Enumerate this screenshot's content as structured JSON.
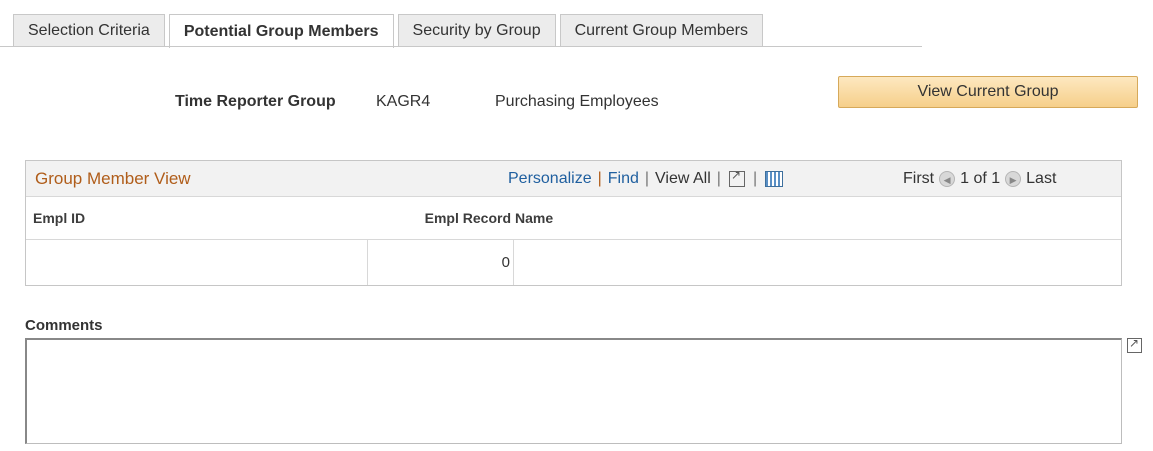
{
  "tabs": [
    {
      "label": "Selection Criteria",
      "active": false
    },
    {
      "label": "Potential Group Members",
      "active": true
    },
    {
      "label": "Security by Group",
      "active": false
    },
    {
      "label": "Current Group Members",
      "active": false
    }
  ],
  "header": {
    "label": "Time Reporter Group",
    "code": "KAGR4",
    "description": "Purchasing Employees",
    "button_label": "View Current Group"
  },
  "grid": {
    "title": "Group Member View",
    "personalize": "Personalize",
    "find": "Find",
    "view_all": "View All",
    "first": "First",
    "page_info": "1 of 1",
    "last": "Last",
    "columns": {
      "empl_id": "Empl ID",
      "empl_record": "Empl Record",
      "name": "Name"
    },
    "rows": [
      {
        "empl_id": "",
        "empl_record": "0",
        "name": ""
      }
    ]
  },
  "comments": {
    "label": "Comments",
    "value": ""
  },
  "colors": {
    "accent_title": "#b05d1a",
    "link": "#1f5f9f",
    "button_bg": "#f6cf8a"
  }
}
